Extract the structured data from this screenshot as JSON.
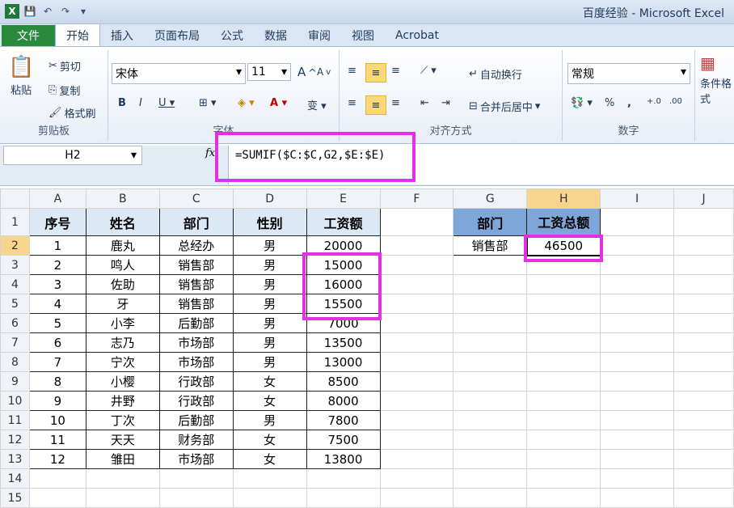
{
  "window_title": "百度经验 - Microsoft Excel",
  "tabs": [
    {
      "label": "文件"
    },
    {
      "label": "开始"
    },
    {
      "label": "插入"
    },
    {
      "label": "页面布局"
    },
    {
      "label": "公式"
    },
    {
      "label": "数据"
    },
    {
      "label": "审阅"
    },
    {
      "label": "视图"
    },
    {
      "label": "Acrobat"
    }
  ],
  "ribbon": {
    "clipboard": {
      "paste": "粘贴",
      "cut": "剪切",
      "copy": "复制",
      "format_painter": "格式刷",
      "group_label": "剪贴板"
    },
    "font": {
      "name": "宋体",
      "size": "11",
      "group_label": "字体"
    },
    "alignment": {
      "wrap": "自动换行",
      "merge": "合并后居中",
      "group_label": "对齐方式"
    },
    "number": {
      "format": "常规",
      "group_label": "数字"
    },
    "styles": {
      "conditional": "条件格式"
    }
  },
  "formula_bar": {
    "name_box": "H2",
    "fx": "fx",
    "formula": "=SUMIF($C:$C,G2,$E:$E)"
  },
  "columns": [
    "A",
    "B",
    "C",
    "D",
    "E",
    "F",
    "G",
    "H",
    "I",
    "J"
  ],
  "rows": [
    "1",
    "2",
    "3",
    "4",
    "5",
    "6",
    "7",
    "8",
    "9",
    "10",
    "11",
    "12",
    "13",
    "14",
    "15"
  ],
  "table": {
    "headers": [
      "序号",
      "姓名",
      "部门",
      "性别",
      "工资额"
    ],
    "rows": [
      [
        "1",
        "鹿丸",
        "总经办",
        "男",
        "20000"
      ],
      [
        "2",
        "鸣人",
        "销售部",
        "男",
        "15000"
      ],
      [
        "3",
        "佐助",
        "销售部",
        "男",
        "16000"
      ],
      [
        "4",
        "牙",
        "销售部",
        "男",
        "15500"
      ],
      [
        "5",
        "小李",
        "后勤部",
        "男",
        "7000"
      ],
      [
        "6",
        "志乃",
        "市场部",
        "男",
        "13500"
      ],
      [
        "7",
        "宁次",
        "市场部",
        "男",
        "13000"
      ],
      [
        "8",
        "小樱",
        "行政部",
        "女",
        "8500"
      ],
      [
        "9",
        "井野",
        "行政部",
        "女",
        "8000"
      ],
      [
        "10",
        "丁次",
        "后勤部",
        "男",
        "7800"
      ],
      [
        "11",
        "天天",
        "财务部",
        "女",
        "7500"
      ],
      [
        "12",
        "雏田",
        "市场部",
        "女",
        "13800"
      ]
    ]
  },
  "summary": {
    "header_dept": "部门",
    "header_total": "工资总额",
    "dept": "销售部",
    "total": "46500"
  },
  "colors": {
    "highlight": "#e62ee6",
    "file_tab": "#2a8a3c",
    "header_blue": "#7ea6d8"
  }
}
